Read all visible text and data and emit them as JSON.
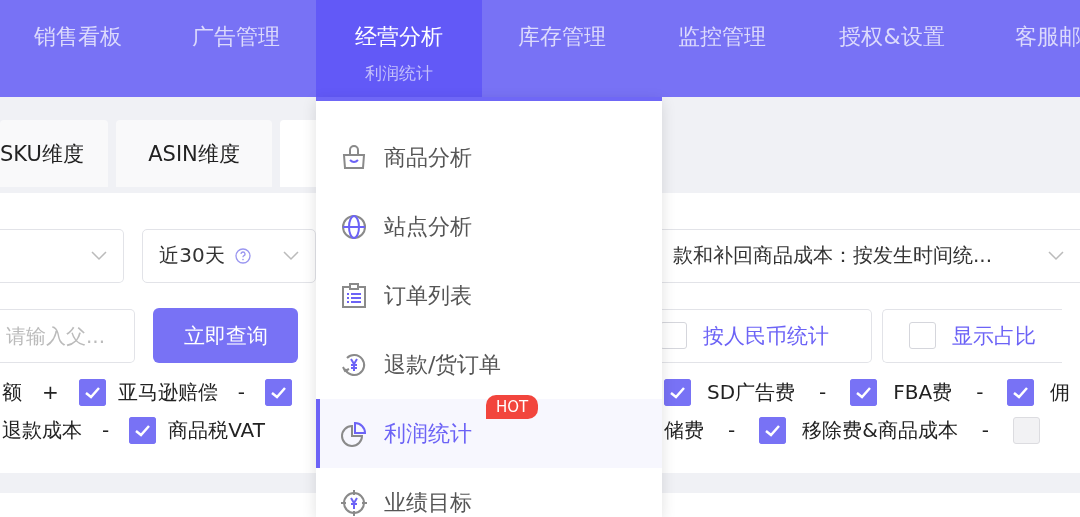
{
  "nav": [
    {
      "label": "销售看板",
      "selected": false
    },
    {
      "label": "广告管理",
      "selected": false
    },
    {
      "label": "经营分析",
      "selected": true,
      "sublabel": "利润统计"
    },
    {
      "label": "库存管理",
      "selected": false
    },
    {
      "label": "监控管理",
      "selected": false
    },
    {
      "label": "授权&设置",
      "selected": false
    },
    {
      "label": "客服邮",
      "selected": false
    }
  ],
  "tabs": [
    {
      "label": "SKU维度",
      "selected": false
    },
    {
      "label": "ASIN维度",
      "selected": false
    },
    {
      "selected": true
    }
  ],
  "filters": {
    "date_select": {
      "value": "近30天"
    },
    "cost_select": {
      "value": "款和补回商品成本：按发生时间统..."
    },
    "search": {
      "placeholder": "请输入父..."
    },
    "query_button": "立即查询",
    "options": [
      {
        "label": "按人民币统计",
        "checked": false
      },
      {
        "label": "显示占比",
        "checked": false
      }
    ]
  },
  "fee_rows": [
    {
      "left": [
        {
          "kind": "label",
          "text": "额"
        },
        {
          "kind": "op",
          "text": "+"
        },
        {
          "kind": "checkbox",
          "checked": true
        },
        {
          "kind": "label",
          "text": "亚马逊赔偿"
        },
        {
          "kind": "op",
          "text": "-"
        },
        {
          "kind": "checkbox",
          "checked": true
        }
      ],
      "right": [
        {
          "kind": "checkbox",
          "checked": true
        },
        {
          "kind": "label",
          "text": "SD广告费"
        },
        {
          "kind": "op",
          "text": "-"
        },
        {
          "kind": "checkbox",
          "checked": true
        },
        {
          "kind": "label",
          "text": "FBA费"
        },
        {
          "kind": "op",
          "text": "-"
        },
        {
          "kind": "checkbox",
          "checked": true
        },
        {
          "kind": "label",
          "text": "佣"
        }
      ]
    },
    {
      "left": [
        {
          "kind": "label",
          "text": "退款成本"
        },
        {
          "kind": "op",
          "text": "-"
        },
        {
          "kind": "checkbox",
          "checked": true
        },
        {
          "kind": "label",
          "text": "商品税VAT"
        }
      ],
      "right": [
        {
          "kind": "label",
          "text": "储费"
        },
        {
          "kind": "op",
          "text": "-"
        },
        {
          "kind": "checkbox",
          "checked": true
        },
        {
          "kind": "label",
          "text": "移除费&商品成本"
        },
        {
          "kind": "op",
          "text": "-"
        },
        {
          "kind": "checkbox",
          "checked": false
        }
      ]
    }
  ],
  "menu": [
    {
      "label": "商品分析",
      "selected": false
    },
    {
      "label": "站点分析",
      "selected": false
    },
    {
      "label": "订单列表",
      "selected": false
    },
    {
      "label": "退款/货订单",
      "selected": false
    },
    {
      "label": "利润统计",
      "selected": true,
      "badge": "HOT"
    },
    {
      "label": "业绩目标",
      "selected": false
    }
  ]
}
